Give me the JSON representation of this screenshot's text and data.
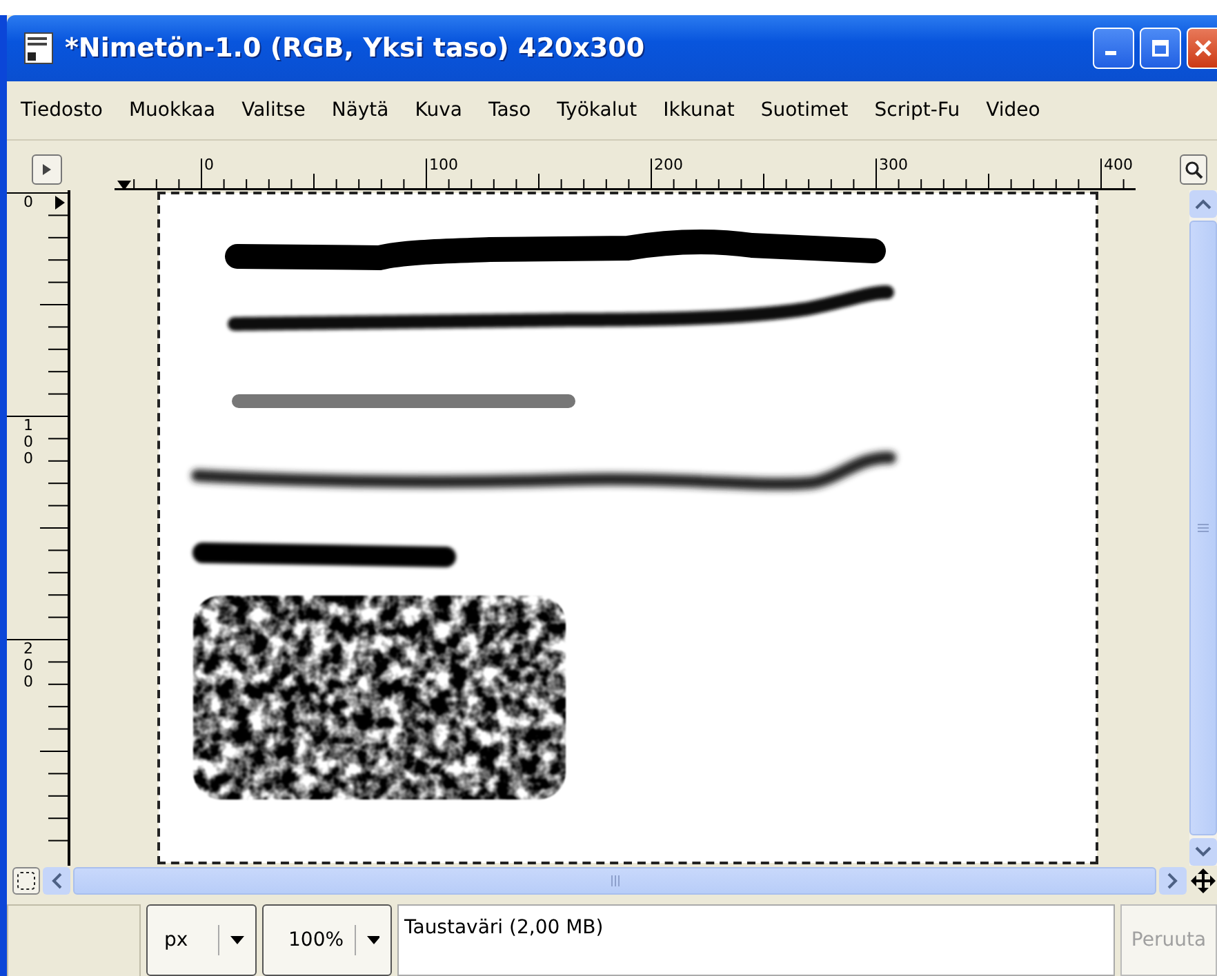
{
  "window": {
    "title": "*Nimetön-1.0 (RGB, Yksi taso) 420x300"
  },
  "menu": [
    "Tiedosto",
    "Muokkaa",
    "Valitse",
    "Näytä",
    "Kuva",
    "Taso",
    "Työkalut",
    "Ikkunat",
    "Suotimet",
    "Script-Fu",
    "Video"
  ],
  "rulers": {
    "horizontal": [
      "0",
      "100",
      "200",
      "300",
      "400"
    ],
    "vertical": [
      "0",
      "100",
      "200"
    ]
  },
  "status_bar": {
    "unit": "px",
    "zoom": "100%",
    "message": "Taustaväri (2,00 MB)",
    "cancel_button": {
      "label": "Peruuta",
      "disabled": true
    }
  }
}
